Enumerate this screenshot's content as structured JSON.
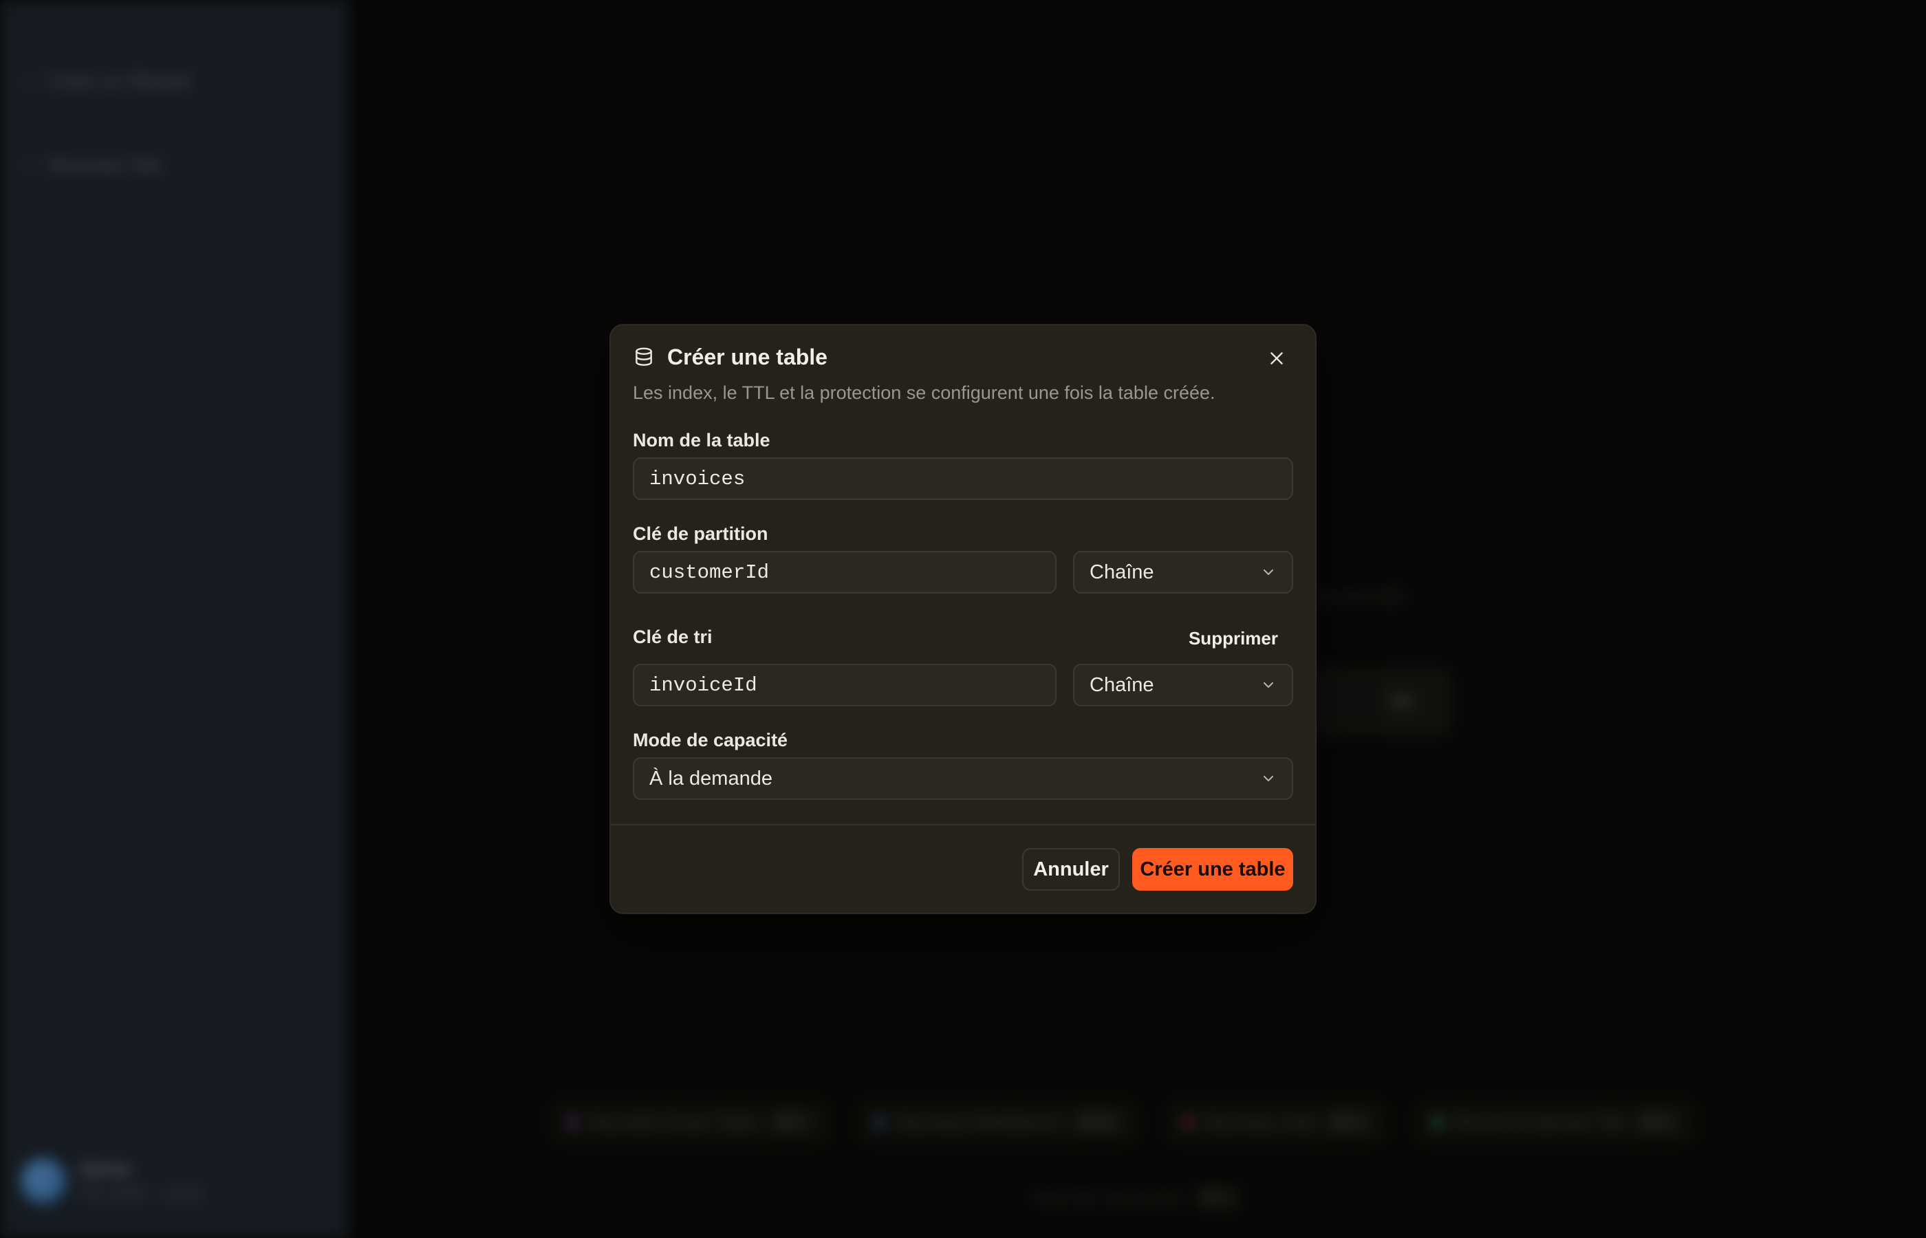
{
  "background": {
    "sidebar": {
      "items": [
        {
          "icon": "plus-icon",
          "label": "Créer un Shared"
        },
        {
          "icon": "plus-icon",
          "label": "Nouveau Tab"
        }
      ],
      "user": {
        "name": "Demo",
        "plan": "Pro 2025 · Local"
      }
    },
    "main": {
      "ghost_text": "Demo2025",
      "card_kbd": "⌘K",
      "shortcuts": [
        {
          "label": "Nouvelle Smart Table",
          "key": "⌘ T",
          "color": "#8a3fa8"
        },
        {
          "label": "Nouveau Workbench",
          "key": "⌘ W",
          "color": "#3a6fb0"
        },
        {
          "label": "Nouveau chat",
          "key": "⌘ C",
          "color": "#b03a3a"
        },
        {
          "label": "Rouvrir le dernier Tab",
          "key": "⌘ Z",
          "color": "#3aa060"
        }
      ],
      "all_shortcuts": {
        "label": "Tous les raccourcis",
        "key": "⌘ /"
      }
    }
  },
  "modal": {
    "title": "Créer une table",
    "subtitle": "Les index, le TTL et la protection se configurent une fois la table créée.",
    "table_name": {
      "label": "Nom de la table",
      "value": "invoices"
    },
    "partition_key": {
      "label": "Clé de partition",
      "value": "customerId",
      "type": "Chaîne"
    },
    "sort_key": {
      "label": "Clé de tri",
      "value": "invoiceId",
      "type": "Chaîne",
      "remove_label": "Supprimer"
    },
    "capacity_mode": {
      "label": "Mode de capacité",
      "value": "À la demande"
    },
    "cancel_label": "Annuler",
    "create_label": "Créer une table"
  },
  "colors": {
    "accent": "#ff5a1f",
    "modal_bg": "#25221b",
    "sidebar_bg": "#222a33"
  }
}
